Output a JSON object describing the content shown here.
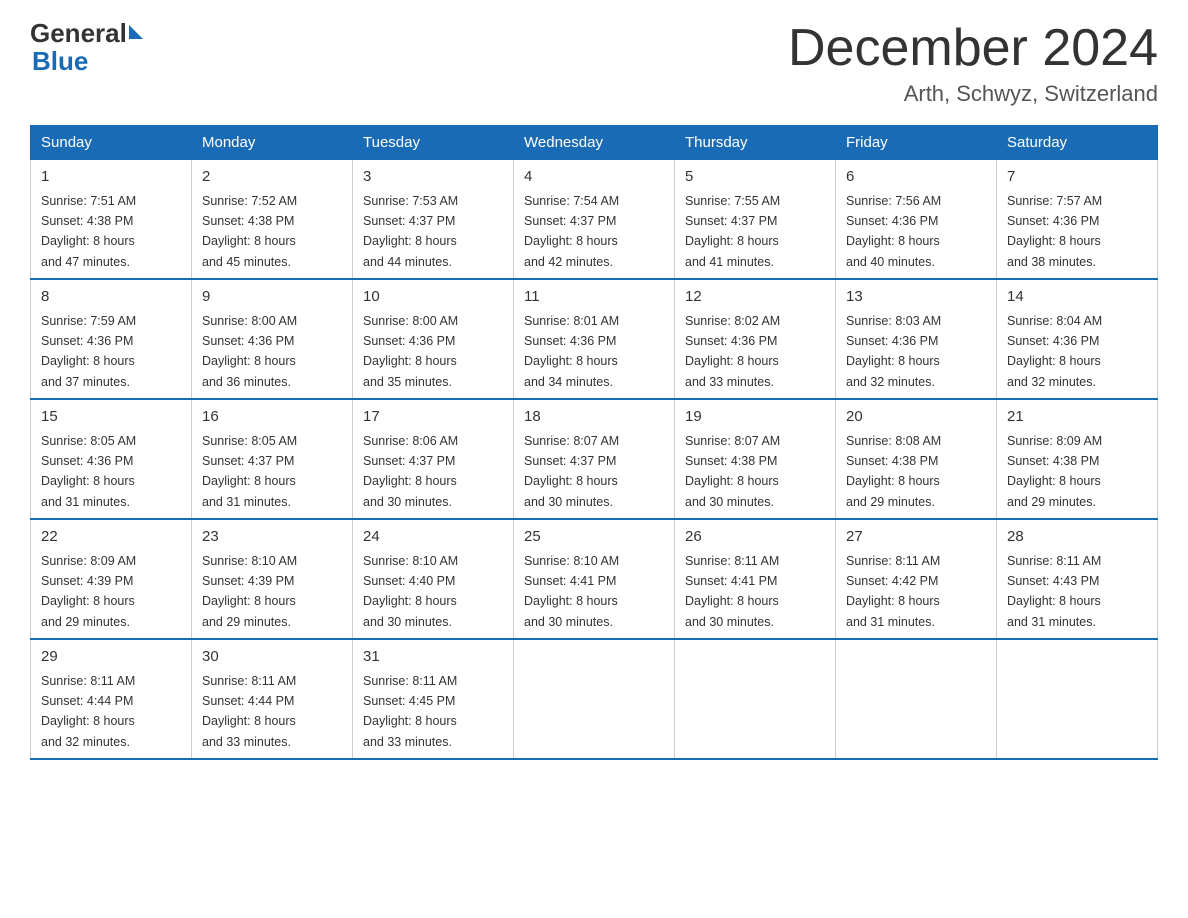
{
  "header": {
    "logo_general": "General",
    "logo_blue": "Blue",
    "month_title": "December 2024",
    "location": "Arth, Schwyz, Switzerland"
  },
  "days_of_week": [
    "Sunday",
    "Monday",
    "Tuesday",
    "Wednesday",
    "Thursday",
    "Friday",
    "Saturday"
  ],
  "weeks": [
    [
      {
        "day": "1",
        "sunrise": "7:51 AM",
        "sunset": "4:38 PM",
        "daylight": "8 hours and 47 minutes."
      },
      {
        "day": "2",
        "sunrise": "7:52 AM",
        "sunset": "4:38 PM",
        "daylight": "8 hours and 45 minutes."
      },
      {
        "day": "3",
        "sunrise": "7:53 AM",
        "sunset": "4:37 PM",
        "daylight": "8 hours and 44 minutes."
      },
      {
        "day": "4",
        "sunrise": "7:54 AM",
        "sunset": "4:37 PM",
        "daylight": "8 hours and 42 minutes."
      },
      {
        "day": "5",
        "sunrise": "7:55 AM",
        "sunset": "4:37 PM",
        "daylight": "8 hours and 41 minutes."
      },
      {
        "day": "6",
        "sunrise": "7:56 AM",
        "sunset": "4:36 PM",
        "daylight": "8 hours and 40 minutes."
      },
      {
        "day": "7",
        "sunrise": "7:57 AM",
        "sunset": "4:36 PM",
        "daylight": "8 hours and 38 minutes."
      }
    ],
    [
      {
        "day": "8",
        "sunrise": "7:59 AM",
        "sunset": "4:36 PM",
        "daylight": "8 hours and 37 minutes."
      },
      {
        "day": "9",
        "sunrise": "8:00 AM",
        "sunset": "4:36 PM",
        "daylight": "8 hours and 36 minutes."
      },
      {
        "day": "10",
        "sunrise": "8:00 AM",
        "sunset": "4:36 PM",
        "daylight": "8 hours and 35 minutes."
      },
      {
        "day": "11",
        "sunrise": "8:01 AM",
        "sunset": "4:36 PM",
        "daylight": "8 hours and 34 minutes."
      },
      {
        "day": "12",
        "sunrise": "8:02 AM",
        "sunset": "4:36 PM",
        "daylight": "8 hours and 33 minutes."
      },
      {
        "day": "13",
        "sunrise": "8:03 AM",
        "sunset": "4:36 PM",
        "daylight": "8 hours and 32 minutes."
      },
      {
        "day": "14",
        "sunrise": "8:04 AM",
        "sunset": "4:36 PM",
        "daylight": "8 hours and 32 minutes."
      }
    ],
    [
      {
        "day": "15",
        "sunrise": "8:05 AM",
        "sunset": "4:36 PM",
        "daylight": "8 hours and 31 minutes."
      },
      {
        "day": "16",
        "sunrise": "8:05 AM",
        "sunset": "4:37 PM",
        "daylight": "8 hours and 31 minutes."
      },
      {
        "day": "17",
        "sunrise": "8:06 AM",
        "sunset": "4:37 PM",
        "daylight": "8 hours and 30 minutes."
      },
      {
        "day": "18",
        "sunrise": "8:07 AM",
        "sunset": "4:37 PM",
        "daylight": "8 hours and 30 minutes."
      },
      {
        "day": "19",
        "sunrise": "8:07 AM",
        "sunset": "4:38 PM",
        "daylight": "8 hours and 30 minutes."
      },
      {
        "day": "20",
        "sunrise": "8:08 AM",
        "sunset": "4:38 PM",
        "daylight": "8 hours and 29 minutes."
      },
      {
        "day": "21",
        "sunrise": "8:09 AM",
        "sunset": "4:38 PM",
        "daylight": "8 hours and 29 minutes."
      }
    ],
    [
      {
        "day": "22",
        "sunrise": "8:09 AM",
        "sunset": "4:39 PM",
        "daylight": "8 hours and 29 minutes."
      },
      {
        "day": "23",
        "sunrise": "8:10 AM",
        "sunset": "4:39 PM",
        "daylight": "8 hours and 29 minutes."
      },
      {
        "day": "24",
        "sunrise": "8:10 AM",
        "sunset": "4:40 PM",
        "daylight": "8 hours and 30 minutes."
      },
      {
        "day": "25",
        "sunrise": "8:10 AM",
        "sunset": "4:41 PM",
        "daylight": "8 hours and 30 minutes."
      },
      {
        "day": "26",
        "sunrise": "8:11 AM",
        "sunset": "4:41 PM",
        "daylight": "8 hours and 30 minutes."
      },
      {
        "day": "27",
        "sunrise": "8:11 AM",
        "sunset": "4:42 PM",
        "daylight": "8 hours and 31 minutes."
      },
      {
        "day": "28",
        "sunrise": "8:11 AM",
        "sunset": "4:43 PM",
        "daylight": "8 hours and 31 minutes."
      }
    ],
    [
      {
        "day": "29",
        "sunrise": "8:11 AM",
        "sunset": "4:44 PM",
        "daylight": "8 hours and 32 minutes."
      },
      {
        "day": "30",
        "sunrise": "8:11 AM",
        "sunset": "4:44 PM",
        "daylight": "8 hours and 33 minutes."
      },
      {
        "day": "31",
        "sunrise": "8:11 AM",
        "sunset": "4:45 PM",
        "daylight": "8 hours and 33 minutes."
      },
      null,
      null,
      null,
      null
    ]
  ],
  "labels": {
    "sunrise": "Sunrise: ",
    "sunset": "Sunset: ",
    "daylight": "Daylight: "
  }
}
